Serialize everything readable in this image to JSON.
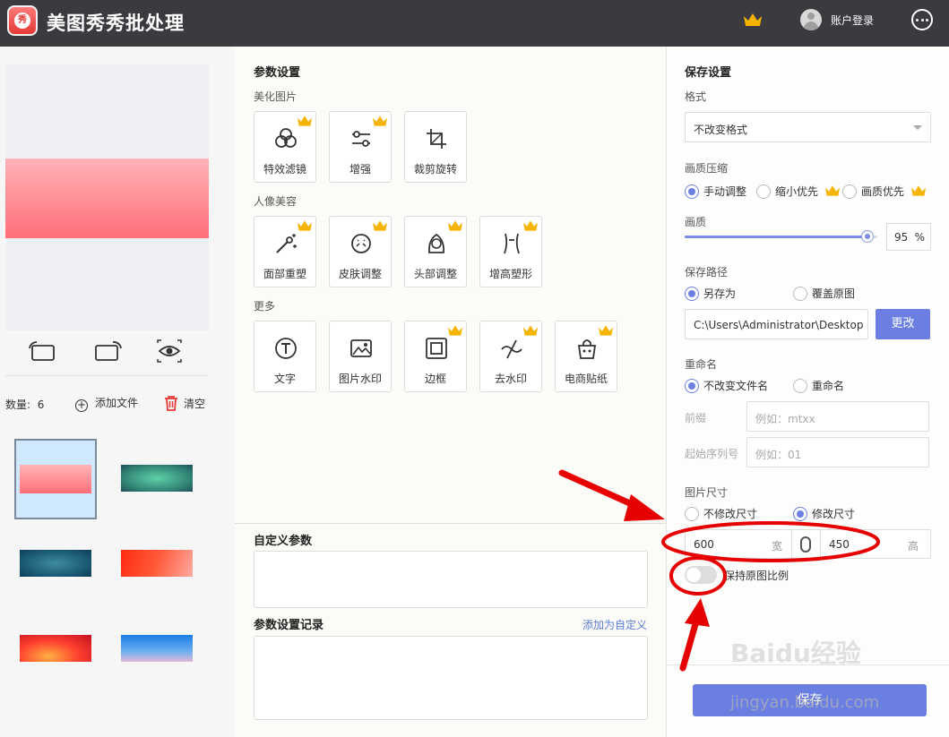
{
  "app": {
    "title": "美图秀秀批处理",
    "login_label": "账户登录"
  },
  "left": {
    "count_label": "数量:",
    "count_value": "6",
    "add_file_label": "添加文件",
    "clear_label": "清空"
  },
  "params": {
    "title": "参数设置",
    "group_beautify": "美化图片",
    "group_portrait": "人像美容",
    "group_more": "更多",
    "tools_beautify": [
      "特效滤镜",
      "增强",
      "裁剪旋转"
    ],
    "tools_portrait": [
      "面部重塑",
      "皮肤调整",
      "头部调整",
      "增高塑形"
    ],
    "tools_more": [
      "文字",
      "图片水印",
      "边框",
      "去水印",
      "电商贴纸"
    ],
    "custom_title": "自定义参数",
    "history_title": "参数设置记录",
    "add_custom_link": "添加为自定义"
  },
  "save": {
    "title": "保存设置",
    "format_label": "格式",
    "format_value": "不改变格式",
    "compress_label": "画质压缩",
    "compress_options": [
      "手动调整",
      "缩小优先",
      "画质优先"
    ],
    "quality_label": "画质",
    "quality_value": "95",
    "quality_unit": "%",
    "quality_level": 0.95,
    "path_label": "保存路径",
    "path_options": [
      "另存为",
      "覆盖原图"
    ],
    "path_value": "C:\\Users\\Administrator\\Desktop",
    "change_button": "更改",
    "rename_label": "重命名",
    "rename_options": [
      "不改变文件名",
      "重命名"
    ],
    "prefix_label": "前缀",
    "prefix_placeholder": "例如：mtxx",
    "start_label": "起始序列号",
    "start_placeholder": "例如：01",
    "size_label": "图片尺寸",
    "size_options": [
      "不修改尺寸",
      "修改尺寸"
    ],
    "width_value": "600",
    "width_unit": "宽",
    "height_value": "450",
    "height_unit": "高",
    "keep_ratio_label": "保持原图比例",
    "save_button": "保存"
  },
  "watermark": {
    "line1": "Baidu经验",
    "line2": "jingyan.baidu.com"
  },
  "colors": {
    "accent": "#6b7fe3",
    "titlebar": "#3a3a3f",
    "annotation": "#e60000",
    "crown": "#f5b400"
  }
}
